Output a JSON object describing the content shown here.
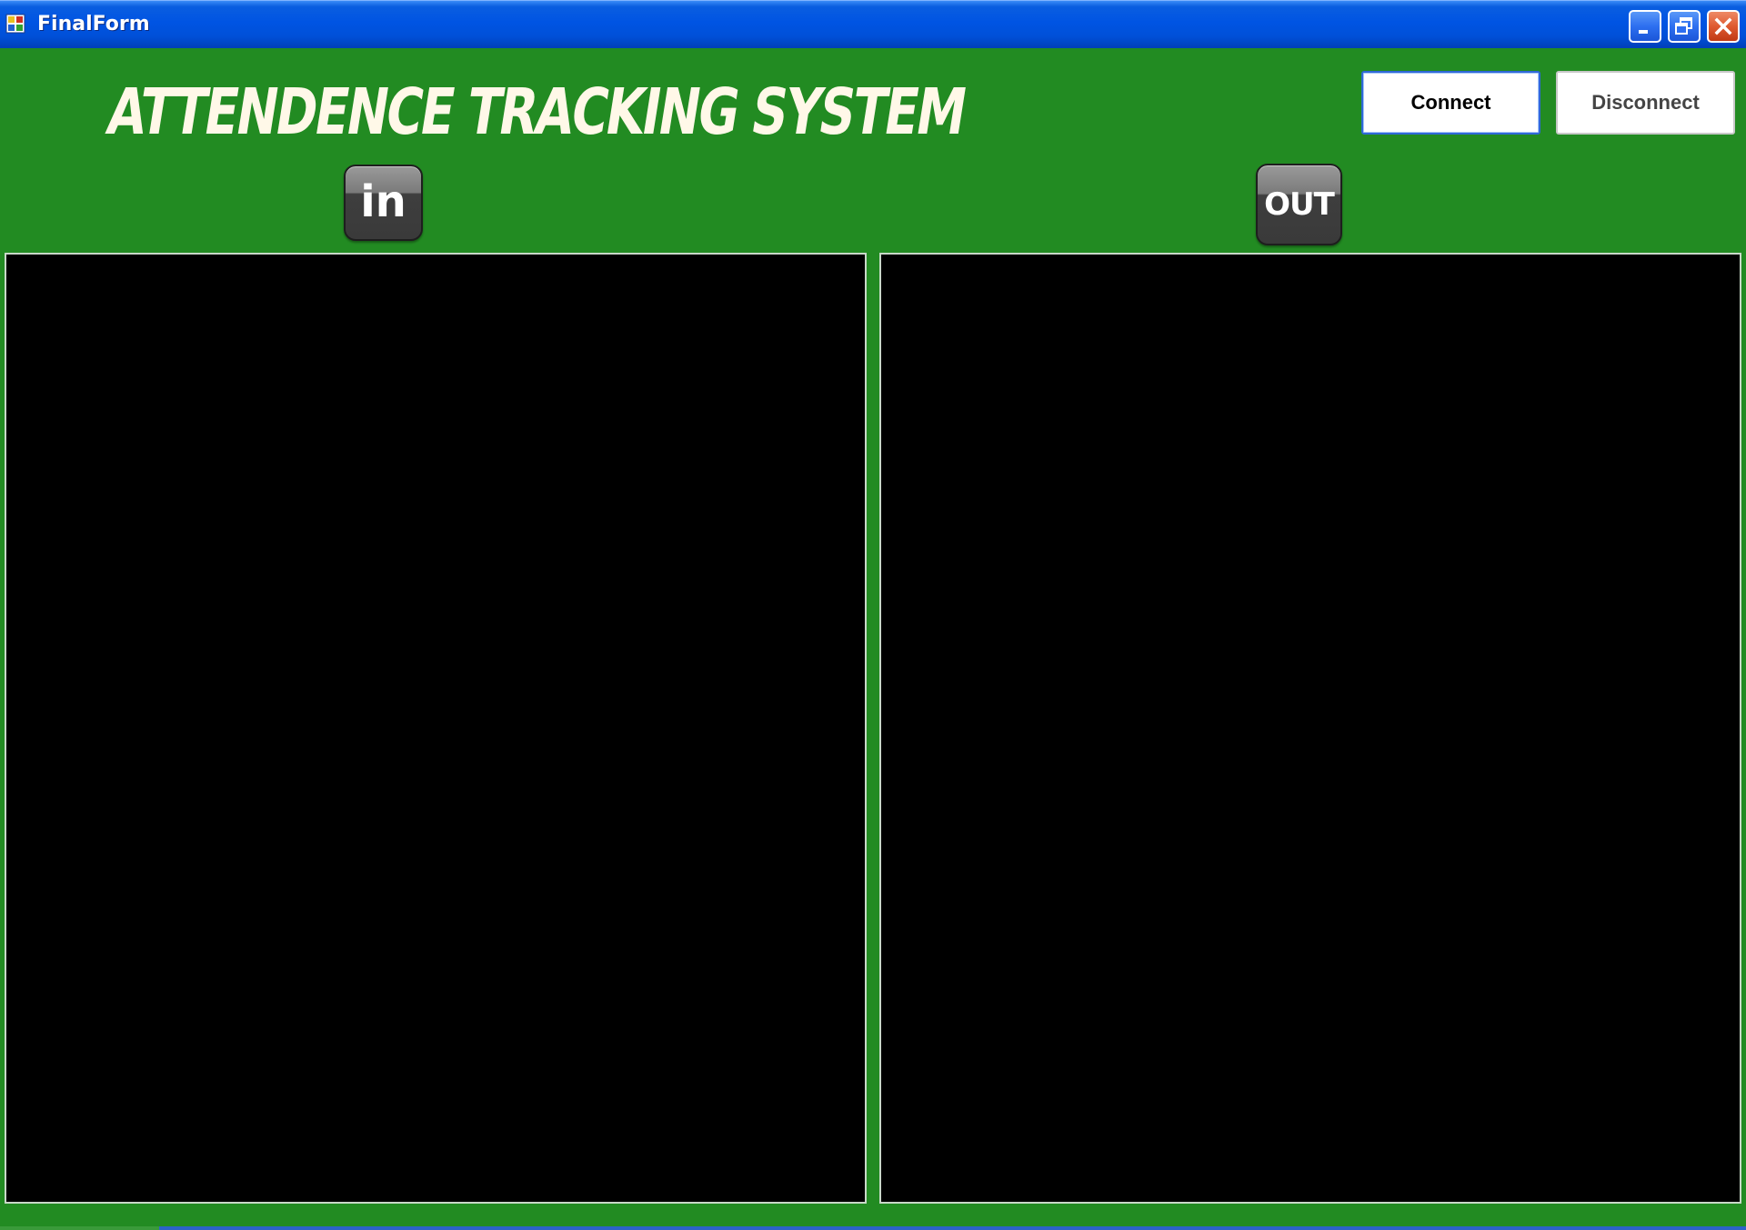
{
  "window": {
    "title": "FinalForm",
    "controls": {
      "minimize": "minimize-icon",
      "maximize": "restore-icon",
      "close": "close-icon"
    }
  },
  "header": {
    "app_title": "ATTENDENCE TRACKING SYSTEM",
    "connect_label": "Connect",
    "disconnect_label": "Disconnect"
  },
  "panels": {
    "in_label": "in",
    "out_label": "OUT"
  },
  "colors": {
    "background": "#228b22",
    "panel": "#000000",
    "titlebar": "#0054e3"
  }
}
